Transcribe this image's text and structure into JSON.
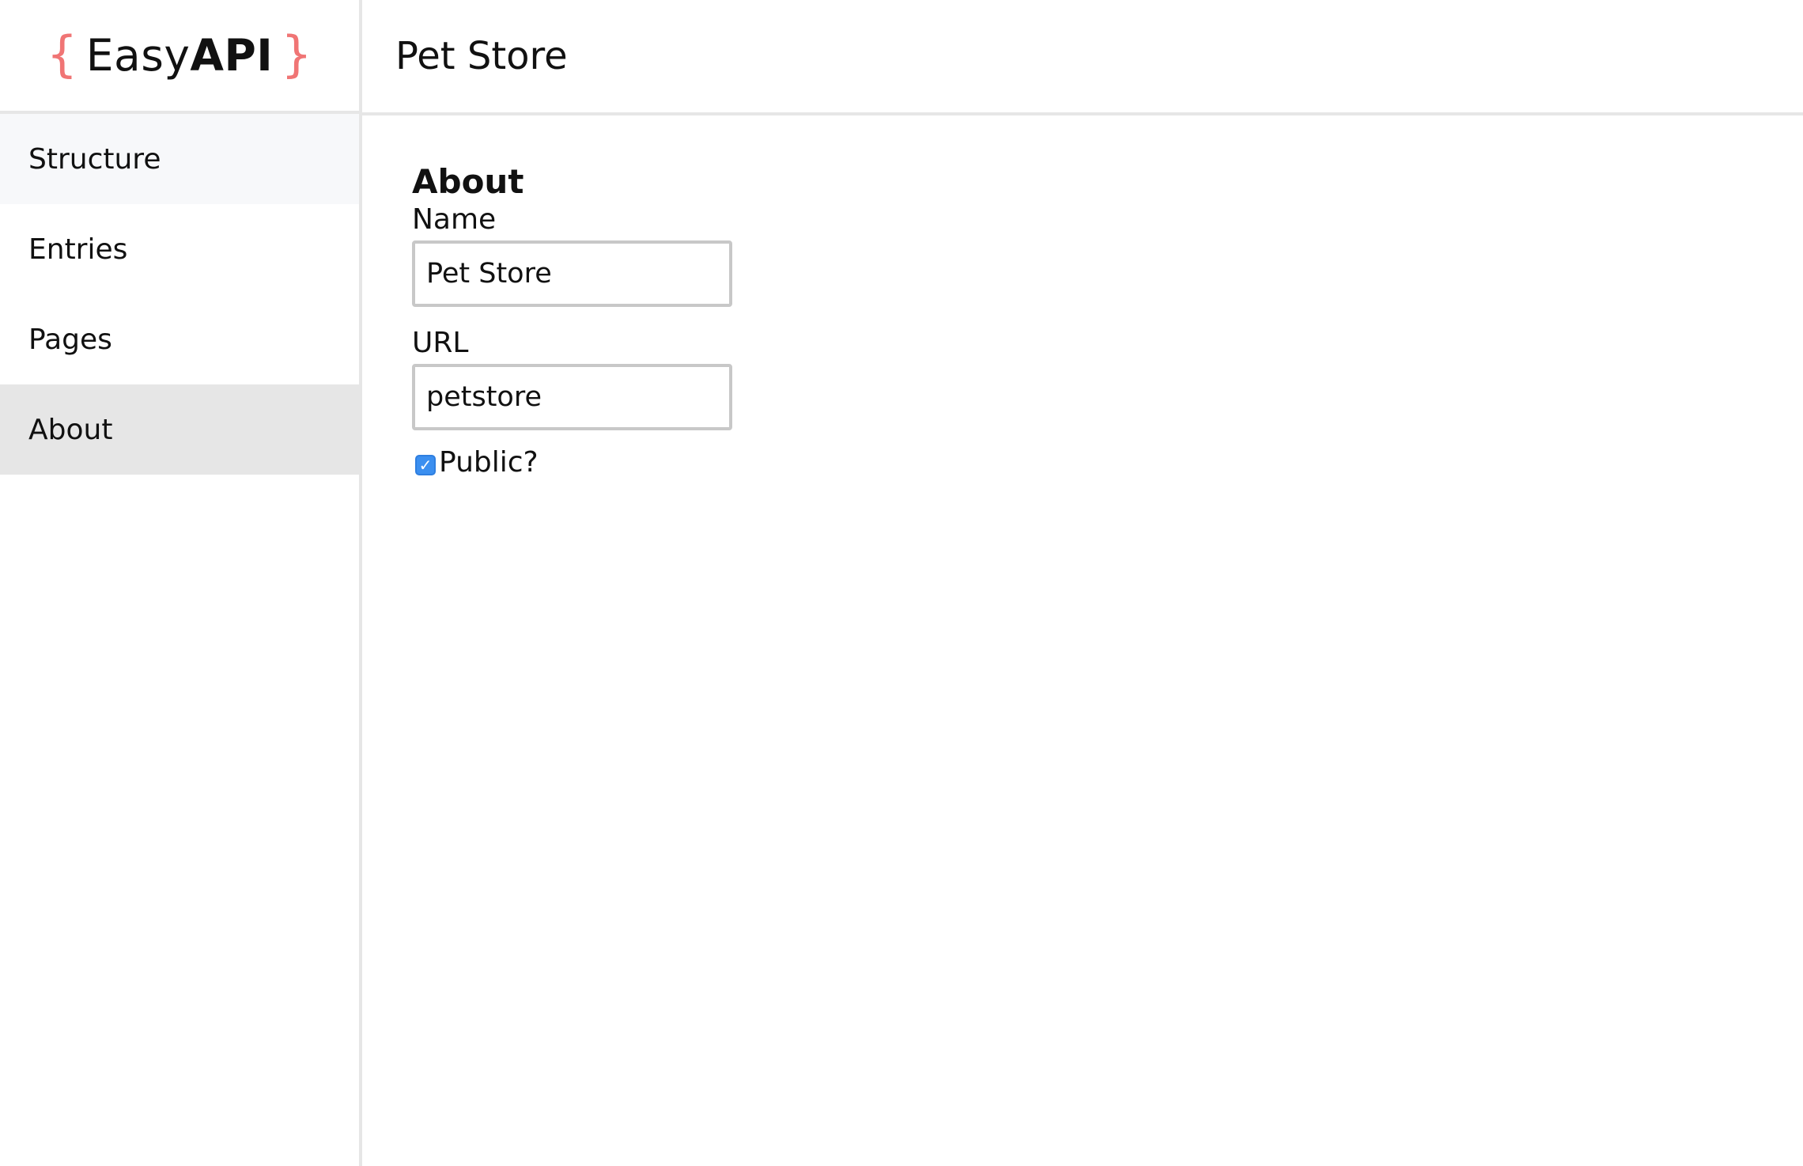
{
  "brand": {
    "open_brace": "{",
    "name_regular": "Easy",
    "name_bold": "API",
    "close_brace": "}",
    "accent_color": "#f07575"
  },
  "header": {
    "title": "Pet Store"
  },
  "sidebar": {
    "items": [
      {
        "label": "Structure",
        "state": "hover"
      },
      {
        "label": "Entries",
        "state": "normal"
      },
      {
        "label": "Pages",
        "state": "normal"
      },
      {
        "label": "About",
        "state": "active"
      }
    ]
  },
  "main": {
    "section_title": "About",
    "name_label": "Name",
    "name_value": "Pet Store",
    "url_label": "URL",
    "url_value": "petstore",
    "public_label": "Public?",
    "public_checked": true,
    "checkbox_color": "#3b8ff0",
    "checkmark_glyph": "✓"
  }
}
